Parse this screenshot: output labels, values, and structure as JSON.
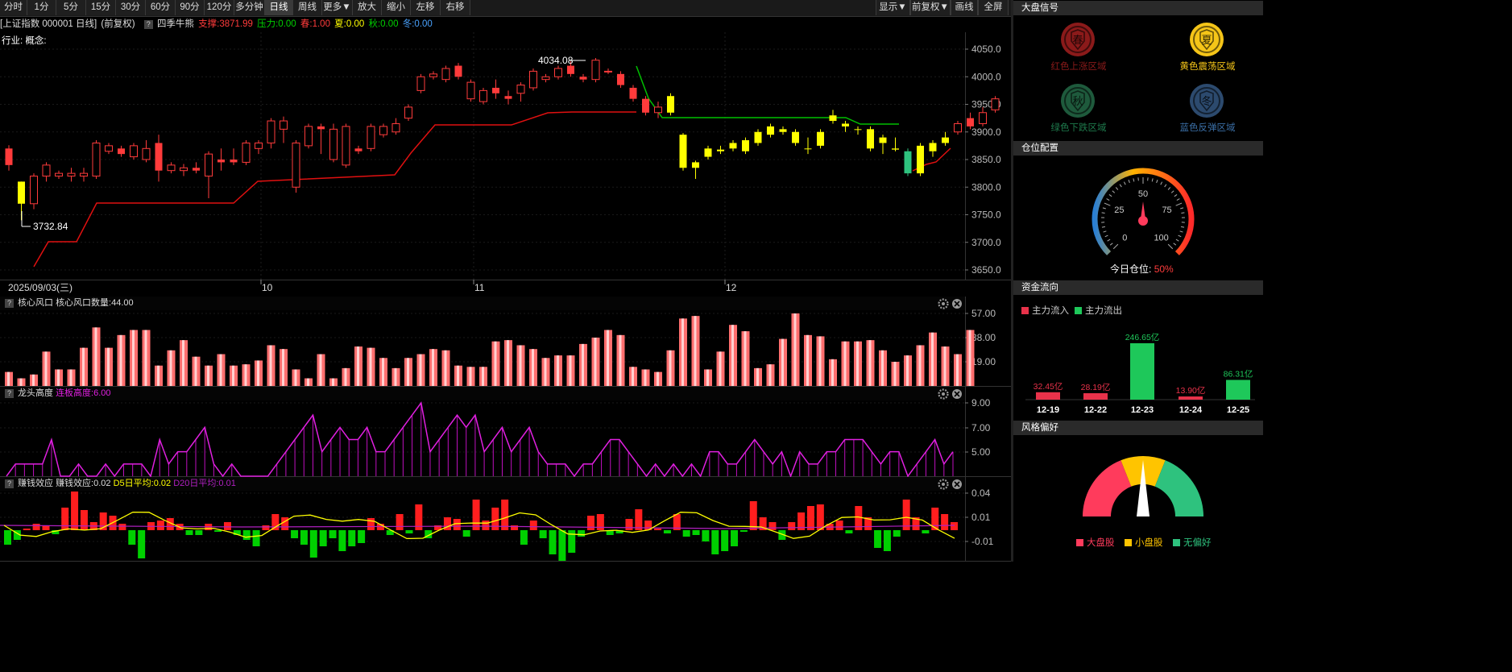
{
  "toolbar": {
    "left": [
      "分时",
      "1分",
      "5分",
      "15分",
      "30分",
      "60分",
      "90分",
      "120分",
      "多分钟",
      "日线",
      "周线",
      "更多▼",
      "放大",
      "缩小",
      "左移",
      "右移"
    ],
    "right": [
      "显示▼",
      "前复权▼",
      "画线",
      "全屏"
    ]
  },
  "info": {
    "symbol": "[上证指数 000001 日线]",
    "adjust": "(前复权)",
    "q": "?",
    "indicator": "四季牛熊",
    "support": "支撑:3871.99",
    "pressure": "压力:0.00",
    "spring": "春:1.00",
    "summer": "夏:0.00",
    "autumn": "秋:0.00",
    "winter": "冬:0.00"
  },
  "industry": "行业: 概念:",
  "main_chart": {
    "y_ticks": [
      "4050.0",
      "4000.0",
      "3950.0",
      "3900.0",
      "3850.0",
      "3800.0",
      "3750.0",
      "3700.0",
      "3650.0"
    ],
    "y_values": [
      4050,
      4000,
      3950,
      3900,
      3850,
      3800,
      3750,
      3700,
      3650
    ],
    "high_label": "4034.08",
    "low_label": "3732.84",
    "date_label": "2025/09/03(三)",
    "month_labels": [
      "10",
      "11",
      "12"
    ]
  },
  "panel1": {
    "q": "?",
    "title": "核心风口",
    "value": "核心风口数量:44.00",
    "ticks": [
      "57.00",
      "38.00",
      "19.00"
    ]
  },
  "panel2": {
    "q": "?",
    "title": "龙头高度",
    "value": "连板高度:6.00",
    "ticks": [
      "9.00",
      "7.00",
      "5.00"
    ]
  },
  "panel3": {
    "q": "?",
    "title": "赚钱效应",
    "value": "赚钱效应:0.02",
    "d5": "D5日平均:0.02",
    "d20": "D20日平均:0.01",
    "ticks": [
      "0.04",
      "0.01",
      "-0.01"
    ]
  },
  "right_panel": {
    "signal_title": "大盘信号",
    "seasons": [
      {
        "glyph": "春",
        "label": "红色上涨区域",
        "color": "#8b1a1a"
      },
      {
        "glyph": "夏",
        "label": "黄色震荡区域",
        "color": "#f5c518"
      },
      {
        "glyph": "秋",
        "label": "绿色下跌区域",
        "color": "#1e5a3c"
      },
      {
        "glyph": "冬",
        "label": "蓝色反弹区域",
        "color": "#2c4a6e"
      }
    ],
    "position_title": "仓位配置",
    "gauge_ticks": [
      "0",
      "25",
      "50",
      "75",
      "100"
    ],
    "position_label": "今日仓位:",
    "position_value": "50%",
    "position_fraction": 0.5,
    "flow_title": "资金流向",
    "flow_in": "主力流入",
    "flow_out": "主力流出",
    "flow_bars": [
      {
        "date": "12-19",
        "label": "32.45亿",
        "value": 32.45,
        "dir": "in"
      },
      {
        "date": "12-22",
        "label": "28.19亿",
        "value": 28.19,
        "dir": "in"
      },
      {
        "date": "12-23",
        "label": "246.65亿",
        "value": 246.65,
        "dir": "out"
      },
      {
        "date": "12-24",
        "label": "13.90亿",
        "value": 13.9,
        "dir": "in"
      },
      {
        "date": "12-25",
        "label": "86.31亿",
        "value": 86.31,
        "dir": "out"
      }
    ],
    "style_title": "风格偏好",
    "style_legend": [
      "大盘股",
      "小盘股",
      "无偏好"
    ]
  },
  "colors": {
    "red": "#ff3b3b",
    "green": "#00c000",
    "yellow": "#ffff00",
    "magenta": "#e020e0",
    "bg": "#000000"
  }
}
